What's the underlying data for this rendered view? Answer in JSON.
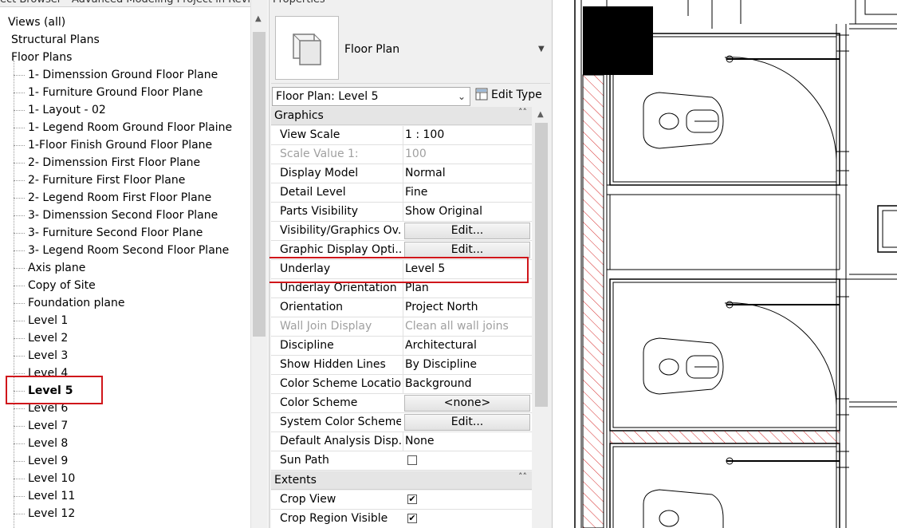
{
  "project_browser": {
    "title": "ect Browser - Advanced Modeling Project in Revit ...",
    "root": "Views (all)",
    "structural_plans": "Structural Plans",
    "floor_plans": "Floor Plans",
    "views": [
      "1- Dimenssion Ground Floor Plane",
      "1- Furniture Ground Floor Plane",
      "1- Layout - 02",
      "1- Legend Room Ground Floor Plaine",
      "1-Floor Finish Ground Floor Plane",
      "2- Dimenssion First Floor Plane",
      "2- Furniture First Floor Plane",
      "2- Legend Room First Floor Plane",
      "3- Dimenssion Second Floor Plane",
      "3- Furniture Second Floor Plane",
      "3- Legend Room Second Floor Plane",
      "Axis plane",
      "Copy of Site",
      "Foundation plane",
      "Level 1",
      "Level 2",
      "Level 3",
      "Level 4",
      "Level 5",
      "Level 6",
      "Level 7",
      "Level 8",
      "Level 9",
      "Level 10",
      "Level 11",
      "Level 12"
    ],
    "selected_view": "Level 5"
  },
  "properties": {
    "title": "Properties",
    "type_name": "Floor Plan",
    "instance_selector": "Floor Plan: Level 5",
    "edit_type_label": "Edit Type",
    "sections": {
      "graphics": "Graphics",
      "extents": "Extents"
    },
    "graphics_rows": [
      {
        "key": "View Scale",
        "value": "1 : 100",
        "kind": "text"
      },
      {
        "key": "Scale Value    1:",
        "value": "100",
        "kind": "text",
        "disabled": true
      },
      {
        "key": "Display Model",
        "value": "Normal",
        "kind": "text"
      },
      {
        "key": "Detail Level",
        "value": "Fine",
        "kind": "text"
      },
      {
        "key": "Parts Visibility",
        "value": "Show Original",
        "kind": "text"
      },
      {
        "key": "Visibility/Graphics Ov...",
        "value": "Edit...",
        "kind": "button"
      },
      {
        "key": "Graphic Display Opti...",
        "value": "Edit...",
        "kind": "button"
      },
      {
        "key": "Underlay",
        "value": "Level 5",
        "kind": "text",
        "highlight": true
      },
      {
        "key": "Underlay Orientation",
        "value": "Plan",
        "kind": "text"
      },
      {
        "key": "Orientation",
        "value": "Project North",
        "kind": "text"
      },
      {
        "key": "Wall Join Display",
        "value": "Clean all wall joins",
        "kind": "text",
        "disabled": true
      },
      {
        "key": "Discipline",
        "value": "Architectural",
        "kind": "text"
      },
      {
        "key": "Show Hidden Lines",
        "value": "By Discipline",
        "kind": "text"
      },
      {
        "key": "Color Scheme Location",
        "value": "Background",
        "kind": "text"
      },
      {
        "key": "Color Scheme",
        "value": "<none>",
        "kind": "button"
      },
      {
        "key": "System Color Schemes",
        "value": "Edit...",
        "kind": "button"
      },
      {
        "key": "Default Analysis Disp...",
        "value": "None",
        "kind": "text"
      },
      {
        "key": "Sun Path",
        "value": "",
        "kind": "checkbox",
        "checked": false
      }
    ],
    "extents_rows": [
      {
        "key": "Crop View",
        "value": "",
        "kind": "checkbox",
        "checked": true
      },
      {
        "key": "Crop Region Visible",
        "value": "",
        "kind": "checkbox",
        "checked": true
      }
    ]
  },
  "colors": {
    "highlight_red": "#d0161b",
    "hatch_red": "#d62a2a"
  }
}
